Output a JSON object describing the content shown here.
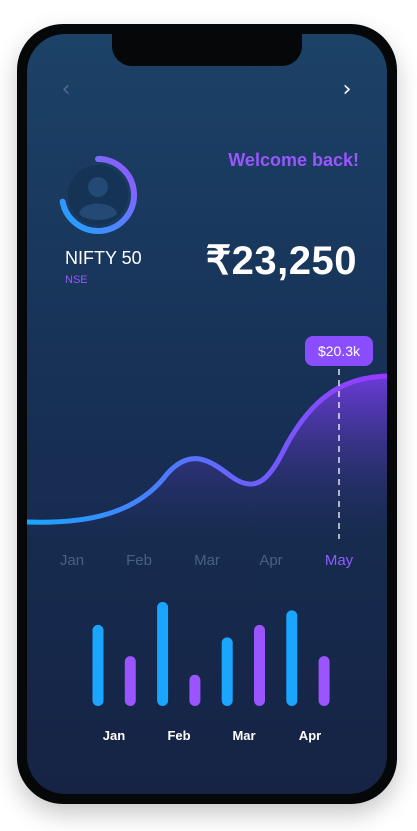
{
  "header": {
    "back_icon": "chevron-left-icon",
    "next_icon": "chevron-right-icon",
    "welcome": "Welcome back!"
  },
  "profile": {
    "avatar_icon": "user-avatar-icon",
    "index_name": "NIFTY 50",
    "exchange": "NSE",
    "progress_ring_fraction": 0.72
  },
  "price": "₹23,250",
  "colors": {
    "accent_purple": "#9a55ff",
    "accent_blue": "#1aa6ff",
    "background_top": "#1c4267",
    "background_bottom": "#162344"
  },
  "chart_data": [
    {
      "type": "area",
      "categories": [
        "Jan",
        "Feb",
        "Mar",
        "Apr",
        "May"
      ],
      "highlight": {
        "category": "May",
        "label": "$20.3k"
      }
    },
    {
      "type": "bar",
      "categories": [
        "Jan",
        "Feb",
        "Mar",
        "Apr"
      ],
      "series_colors": [
        "#1aa6ff",
        "#9a55ff"
      ],
      "values": [
        0.78,
        0.48,
        1.0,
        0.3,
        0.66,
        0.78,
        0.92,
        0.48
      ]
    }
  ]
}
